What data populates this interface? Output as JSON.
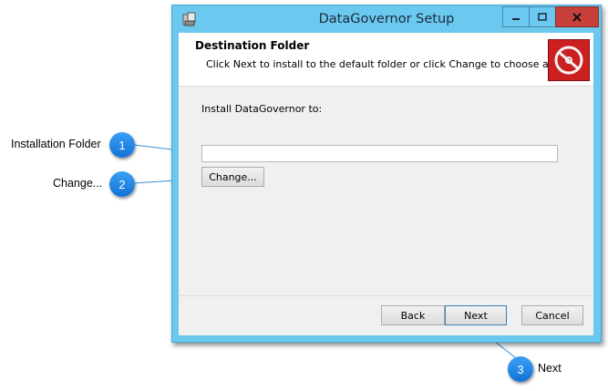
{
  "window": {
    "title": "DataGovernor Setup",
    "colors": {
      "frame": "#6bc8ee",
      "close": "#c7403a"
    }
  },
  "header": {
    "title": "Destination Folder",
    "subtitle": "Click Next to install to the default folder or click Change to choose anot..."
  },
  "body": {
    "install_label": "Install DataGovernor to:",
    "path_value": "",
    "change_label": "Change..."
  },
  "footer": {
    "back_label": "Back",
    "next_label": "Next",
    "cancel_label": "Cancel"
  },
  "callouts": [
    {
      "number": "1",
      "label": "Installation Folder"
    },
    {
      "number": "2",
      "label": "Change..."
    },
    {
      "number": "3",
      "label": "Next"
    }
  ],
  "icons": [
    "installer-app-icon",
    "minimize-icon",
    "maximize-icon",
    "close-icon",
    "disc-logo-icon"
  ]
}
